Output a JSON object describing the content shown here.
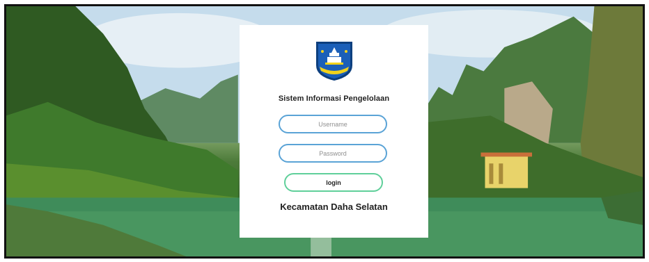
{
  "login_form": {
    "title": "Sistem Informasi Pengelolaan",
    "username_placeholder": "Username",
    "password_placeholder": "Password",
    "login_label": "login",
    "subtitle": "Kecamatan Daha Selatan"
  },
  "logo": {
    "icon": "regency-crest-icon",
    "colors": {
      "shield": "#1b5fb8",
      "border": "#0d3f7e",
      "ribbon": "#f2d21b"
    }
  },
  "background": {
    "icon": "lake-landscape-photo"
  },
  "colors": {
    "input_border": "#5aa3d6",
    "login_border": "#5fcf9a",
    "card": "#ffffff"
  }
}
